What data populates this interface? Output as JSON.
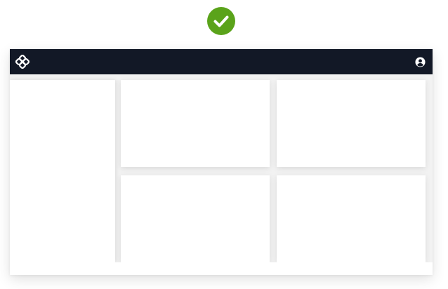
{
  "colors": {
    "success_badge": "#5aa31a",
    "topbar_bg": "#121826",
    "icon_fg": "#ffffff"
  },
  "icons": {
    "success": "checkmark-icon",
    "logo": "app-logo-icon",
    "account": "user-account-icon"
  }
}
